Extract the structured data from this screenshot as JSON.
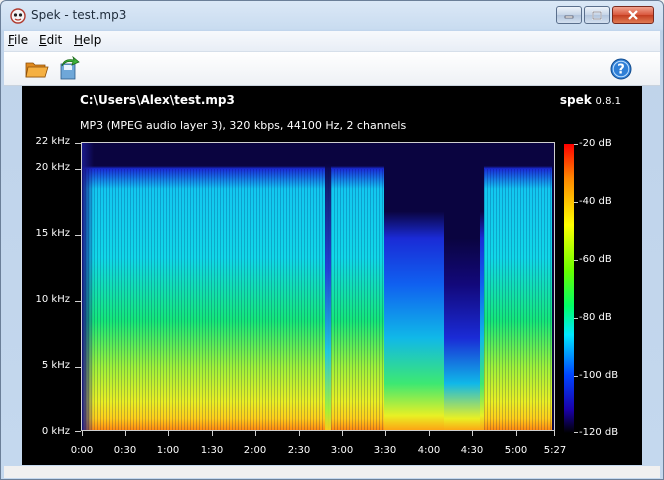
{
  "window": {
    "title": "Spek - test.mp3"
  },
  "menu": [
    {
      "label": "File",
      "underline": "F",
      "rest": "ile"
    },
    {
      "label": "Edit",
      "underline": "E",
      "rest": "dit"
    },
    {
      "label": "Help",
      "underline": "H",
      "rest": "elp"
    }
  ],
  "toolbar": {
    "open_icon": "folder-open-icon",
    "save_icon": "save-export-icon",
    "help_icon": "help-icon"
  },
  "header": {
    "file_path": "C:\\Users\\Alex\\test.mp3",
    "brand_name": "spek",
    "brand_version": "0.8.1",
    "file_info": "MP3 (MPEG audio layer 3), 320 kbps, 44100 Hz, 2 channels"
  },
  "axes": {
    "frequency_labels": [
      "22 kHz",
      "20 kHz",
      "15 kHz",
      "10 kHz",
      "5 kHz",
      "0 kHz"
    ],
    "frequency_values": [
      22,
      20,
      15,
      10,
      5,
      0
    ],
    "time_labels": [
      "0:00",
      "0:30",
      "1:00",
      "1:30",
      "2:00",
      "2:30",
      "3:00",
      "3:30",
      "4:00",
      "4:30",
      "5:00",
      "5:27"
    ],
    "time_values_s": [
      0,
      30,
      60,
      90,
      120,
      150,
      180,
      210,
      240,
      270,
      300,
      327
    ],
    "db_labels": [
      "-20 dB",
      "-40 dB",
      "-60 dB",
      "-80 dB",
      "-100 dB",
      "-120 dB"
    ],
    "db_values": [
      -20,
      -40,
      -60,
      -80,
      -100,
      -120
    ]
  },
  "colors": {
    "background": "#000000",
    "text": "#ffffff"
  }
}
